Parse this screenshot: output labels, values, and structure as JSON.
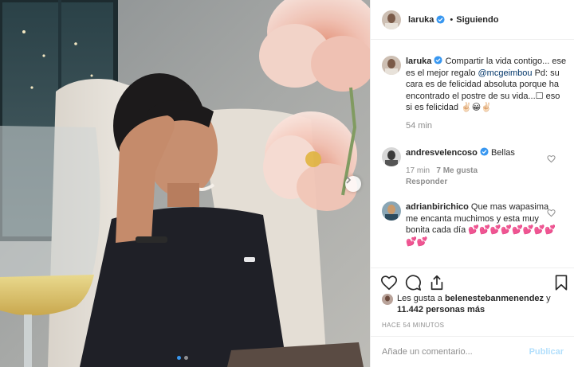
{
  "post": {
    "image_alt": "photo",
    "carousel": {
      "dot_count": 2,
      "active_index": 0
    },
    "next_icon": "chevron-right-icon"
  },
  "header": {
    "username": "laruka",
    "verified": true,
    "separator": "•",
    "follow_status": "Siguiendo"
  },
  "caption": {
    "username": "laruka",
    "text_part1": "Compartir la vida contigo... ese es el mejor regalo ",
    "mention": "@mcgeimbou",
    "text_part2": " Pd: su cara es de felicidad absoluta porque ha encontrado el postre de su vida...☐ eso si es felicidad ✌🏻😀✌🏻",
    "time": "54 min"
  },
  "comments": [
    {
      "username": "andresvelencoso",
      "verified": true,
      "text": "Bellas",
      "time": "17 min",
      "likes": "7 Me gusta",
      "reply": "Responder"
    },
    {
      "username": "adrianbirichico",
      "verified": false,
      "text": "Que mas wapasima me encanta muchimos y esta muy bonita cada día 💕💕💕💕💕💕💕💕💕💕",
      "time": "",
      "likes": "",
      "reply": ""
    }
  ],
  "actions": {
    "like_icon": "heart-icon",
    "comment_icon": "comment-icon",
    "share_icon": "share-icon",
    "save_icon": "bookmark-icon"
  },
  "likes": {
    "prefix": "Les gusta a ",
    "user": "belenestebanmenendez",
    "middle": " y",
    "count": "11.442 personas más"
  },
  "timestamp": "HACE 54 MINUTOS",
  "add_comment": {
    "placeholder": "Añade un comentario...",
    "publish": "Publicar"
  },
  "colors": {
    "link": "#003569",
    "blue": "#3897f0",
    "publish_disabled": "#b2dffc",
    "muted": "#8e8e8e"
  }
}
